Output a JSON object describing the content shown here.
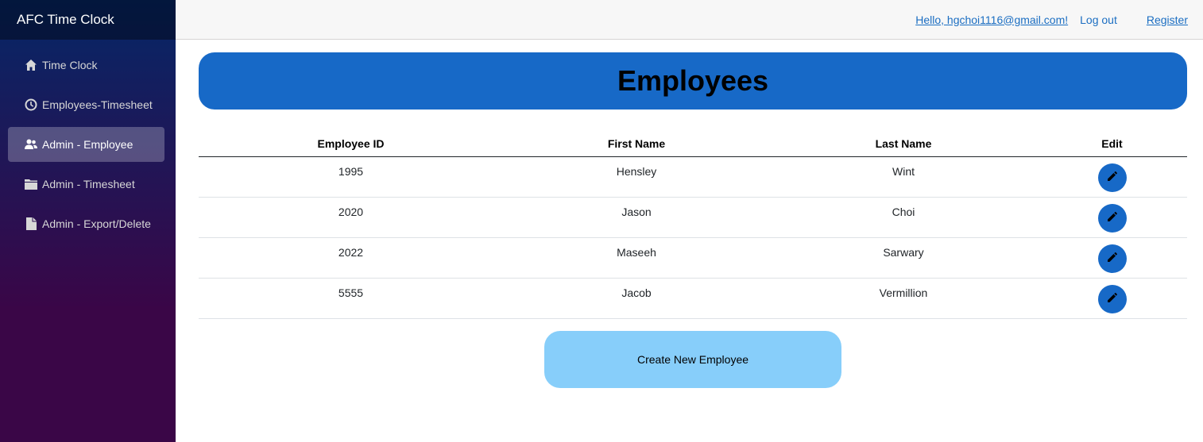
{
  "app": {
    "title": "AFC Time Clock"
  },
  "sidebar": {
    "items": [
      {
        "label": "Time Clock",
        "icon": "home-icon",
        "active": false
      },
      {
        "label": "Employees-Timesheet",
        "icon": "clock-icon",
        "active": false
      },
      {
        "label": "Admin - Employee",
        "icon": "people-icon",
        "active": true
      },
      {
        "label": "Admin - Timesheet",
        "icon": "folder-icon",
        "active": false
      },
      {
        "label": "Admin - Export/Delete",
        "icon": "file-icon",
        "active": false
      }
    ]
  },
  "topbar": {
    "hello": "Hello, hgchoi1116@gmail.com!",
    "logout": "Log out",
    "register": "Register"
  },
  "page": {
    "title": "Employees"
  },
  "table": {
    "headers": [
      "Employee ID",
      "First Name",
      "Last Name",
      "Edit"
    ],
    "rows": [
      [
        "1995",
        "Hensley",
        "Wint"
      ],
      [
        "2020",
        "Jason",
        "Choi"
      ],
      [
        "2022",
        "Maseeh",
        "Sarwary"
      ],
      [
        "5555",
        "Jacob",
        "Vermillion"
      ]
    ]
  },
  "create_button": "Create New Employee",
  "colors": {
    "primary": "#1769c7",
    "create": "#87cefa"
  }
}
